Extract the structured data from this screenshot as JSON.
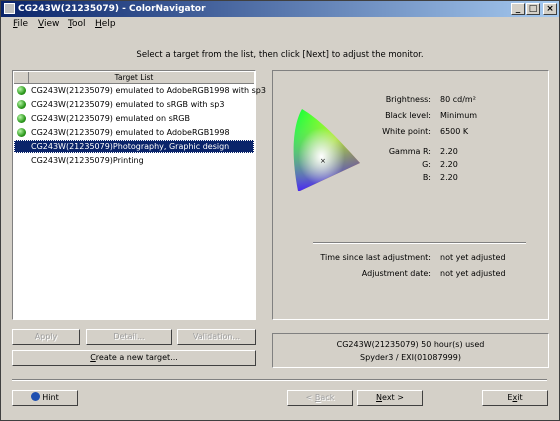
{
  "window": {
    "title": "CG243W(21235079) - ColorNavigator"
  },
  "title_buttons": {
    "minimize": "_",
    "maximize": "□",
    "close": "×"
  },
  "menu": [
    {
      "hot": "F",
      "rest": "ile"
    },
    {
      "hot": "V",
      "rest": "iew"
    },
    {
      "hot": "T",
      "rest": "ool"
    },
    {
      "hot": "H",
      "rest": "elp"
    }
  ],
  "instruction": "Select a target from the list, then click [Next] to adjust the monitor.",
  "target_list": {
    "header": "Target List",
    "items": [
      {
        "label": "CG243W(21235079) emulated to AdobeRGB1998 with sp3",
        "icon": "green-circle",
        "selected": false
      },
      {
        "label": "CG243W(21235079) emulated to sRGB with sp3",
        "icon": "green-circle",
        "selected": false
      },
      {
        "label": "CG243W(21235079) emulated on sRGB",
        "icon": "green-circle",
        "selected": false
      },
      {
        "label": "CG243W(21235079) emulated to AdobeRGB1998",
        "icon": "green-circle",
        "selected": false
      },
      {
        "label": "CG243W(21235079)Photography, Graphic design",
        "icon": "",
        "selected": true
      },
      {
        "label": "CG243W(21235079)Printing",
        "icon": "",
        "selected": false
      }
    ]
  },
  "list_buttons": {
    "apply": "Apply",
    "detail": "Detail...",
    "validation": "Validation...",
    "create_hot": "C",
    "create_rest": "reate a new target..."
  },
  "settings": {
    "brightness_label": "Brightness:",
    "brightness_value": "80 cd/m²",
    "black_label": "Black level:",
    "black_value": "Minimum",
    "white_label": "White point:",
    "white_value": "6500 K",
    "gamma_r_label": "Gamma R:",
    "gamma_r_value": "2.20",
    "gamma_g_label": "G:",
    "gamma_g_value": "2.20",
    "gamma_b_label": "B:",
    "gamma_b_value": "2.20",
    "time_label": "Time since last adjustment:",
    "time_value": "not yet adjusted",
    "date_label": "Adjustment date:",
    "date_value": "not yet adjusted"
  },
  "monitor_info": {
    "usage": "CG243W(21235079) 50 hour(s) used",
    "sensor": "Spyder3 / EXI(01087999)"
  },
  "footer_buttons": {
    "hint": "Hint",
    "back_prefix": "< ",
    "back_hot": "B",
    "back_rest": "ack",
    "next_hot": "N",
    "next_rest": "ext >",
    "exit_prefix": "E",
    "exit_hot": "x",
    "exit_rest": "it"
  },
  "colors": {
    "selection": "#0a246a",
    "titlebar_start": "#0a246a",
    "titlebar_end": "#a6caf0",
    "face": "#d4d0c8"
  }
}
